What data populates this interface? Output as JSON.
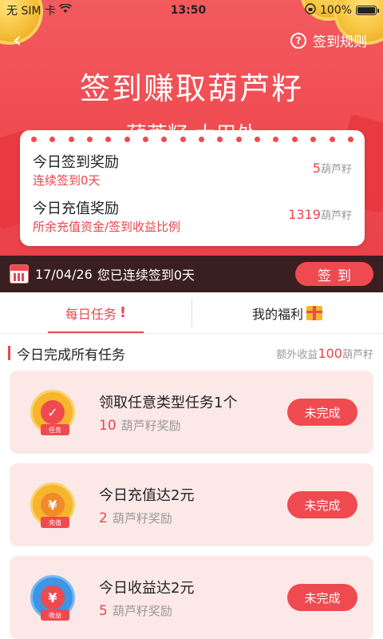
{
  "status_bar": {
    "carrier": "无 SIM 卡",
    "time": "13:50",
    "battery_text": "100%",
    "battery_level": 1.0
  },
  "header": {
    "rules_label": "签到规则",
    "title": "签到赚取葫芦籽",
    "subtitle": "葫芦籽 大用处"
  },
  "rewards": {
    "today_signin_label": "今日签到奖励",
    "streak_text": "连续签到0天",
    "signin_value": "5",
    "signin_unit": "葫芦籽",
    "recharge_label": "今日充值奖励",
    "recharge_desc": "所余充值资金/签到收益比例",
    "recharge_value": "1319",
    "recharge_unit": "葫芦籽"
  },
  "sign_bar": {
    "date": "17/04/26",
    "status": "您已连续签到0天",
    "button_label": "签到"
  },
  "tabs": [
    {
      "label": "每日任务"
    },
    {
      "label": "我的福利"
    }
  ],
  "section": {
    "title": "今日完成所有任务",
    "extra_prefix": "额外收益",
    "extra_value": "100",
    "extra_unit": "葫芦籽"
  },
  "tasks": [
    {
      "title": "领取任意类型任务1个",
      "reward_value": "10",
      "reward_unit": "葫芦籽奖励",
      "button": "未完成",
      "badge": "任务"
    },
    {
      "title": "今日充值达2元",
      "reward_value": "2",
      "reward_unit": "葫芦籽奖励",
      "button": "未完成",
      "badge": "充值"
    },
    {
      "title": "今日收益达2元",
      "reward_value": "5",
      "reward_unit": "葫芦籽奖励",
      "button": "未完成",
      "badge": "收益"
    }
  ],
  "colors": {
    "accent": "#ef4a50",
    "sign_bar_bg": "#3a1f21",
    "task_bg": "#fde8e8",
    "coin": "#f6c23c"
  }
}
